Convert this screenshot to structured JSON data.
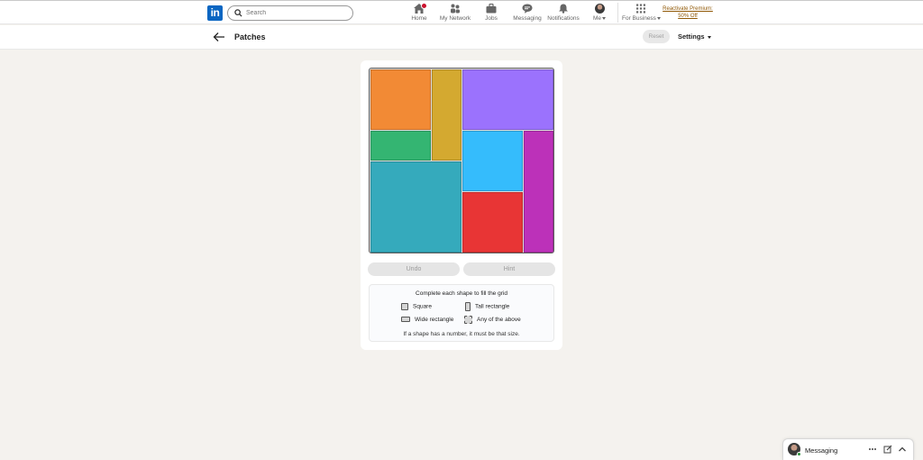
{
  "nav": {
    "logo_text": "in",
    "search_placeholder": "Search",
    "items": [
      {
        "label": "Home",
        "icon": "home-icon"
      },
      {
        "label": "My Network",
        "icon": "network-icon"
      },
      {
        "label": "Jobs",
        "icon": "briefcase-icon"
      },
      {
        "label": "Messaging",
        "icon": "messaging-icon"
      },
      {
        "label": "Notifications",
        "icon": "bell-icon"
      },
      {
        "label": "Me",
        "icon": "avatar"
      },
      {
        "label": "For Business",
        "icon": "grid-icon"
      }
    ],
    "premium_line1": "Reactivate Premium:",
    "premium_line2": "50% Off"
  },
  "subheader": {
    "title": "Patches",
    "reset_label": "Reset",
    "settings_label": "Settings"
  },
  "game": {
    "grid_size": 6,
    "pieces": [
      {
        "color": "#f28a35",
        "row": 0,
        "col": 0,
        "rows": 2,
        "cols": 2
      },
      {
        "color": "#d4a930",
        "row": 0,
        "col": 2,
        "rows": 3,
        "cols": 1
      },
      {
        "color": "#9b72fd",
        "row": 0,
        "col": 3,
        "rows": 2,
        "cols": 3
      },
      {
        "color": "#34b572",
        "row": 2,
        "col": 0,
        "rows": 1,
        "cols": 2
      },
      {
        "color": "#35bcfc",
        "row": 2,
        "col": 3,
        "rows": 2,
        "cols": 2
      },
      {
        "color": "#bc31b9",
        "row": 2,
        "col": 5,
        "rows": 4,
        "cols": 1
      },
      {
        "color": "#35aabc",
        "row": 3,
        "col": 0,
        "rows": 3,
        "cols": 3
      },
      {
        "color": "#e83535",
        "row": 4,
        "col": 3,
        "rows": 2,
        "cols": 2
      }
    ],
    "undo_label": "Undo",
    "hint_label": "Hint"
  },
  "legend": {
    "title": "Complete each shape to fill the grid",
    "square": "Square",
    "tall": "Tall rectangle",
    "wide": "Wide rectangle",
    "any": "Any of the above",
    "note": "If a shape has a number, it must be that size."
  },
  "messaging": {
    "label": "Messaging"
  }
}
